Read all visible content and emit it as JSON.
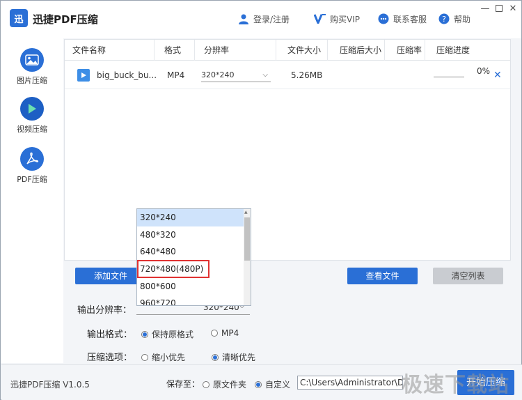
{
  "app": {
    "title": "迅捷PDF压缩",
    "logo_text": "迅",
    "version": "迅捷PDF压缩 V1.0.5"
  },
  "header": {
    "login_label": "登录/注册",
    "vip_label": "购买VIP",
    "support_label": "联系客服",
    "help_label": "帮助"
  },
  "sidebar": {
    "items": [
      {
        "label": "图片压缩",
        "icon": "image-icon"
      },
      {
        "label": "视频压缩",
        "icon": "play-icon"
      },
      {
        "label": "PDF压缩",
        "icon": "pdf-icon"
      }
    ]
  },
  "table": {
    "columns": [
      "文件名称",
      "格式",
      "分辨率",
      "文件大小",
      "压缩后大小",
      "压缩率",
      "压缩进度"
    ],
    "rows": [
      {
        "name": "big_buck_bu...",
        "format": "MP4",
        "resolution": "320*240",
        "size": "5.26MB",
        "compressed_size": "",
        "rate": "",
        "progress_text": "0%",
        "progress_value": 0
      }
    ]
  },
  "buttons": {
    "add_file": "添加文件",
    "view_file": "查看文件",
    "clear_list": "清空列表",
    "start": "开始压缩"
  },
  "dropdown": {
    "options": [
      "320*240",
      "480*320",
      "640*480",
      "720*480(480P)",
      "800*600",
      "960*720"
    ],
    "highlighted": "720*480(480P)"
  },
  "settings": {
    "output_resolution_label": "输出分辨率：",
    "output_resolution_value": "320*240",
    "output_format_label": "输出格式：",
    "format_options": [
      "保持原格式",
      "MP4"
    ],
    "compress_label": "压缩选项：",
    "compress_options": [
      "缩小优先",
      "清晰优先"
    ]
  },
  "footer": {
    "save_to_label": "保存至：",
    "save_options": [
      "原文件夹",
      "自定义"
    ],
    "path_value": "C:\\Users\\Administrator\\D"
  },
  "watermark": "极速下载站",
  "colors": {
    "accent": "#2a6fd6",
    "highlight_box": "#e03232"
  }
}
